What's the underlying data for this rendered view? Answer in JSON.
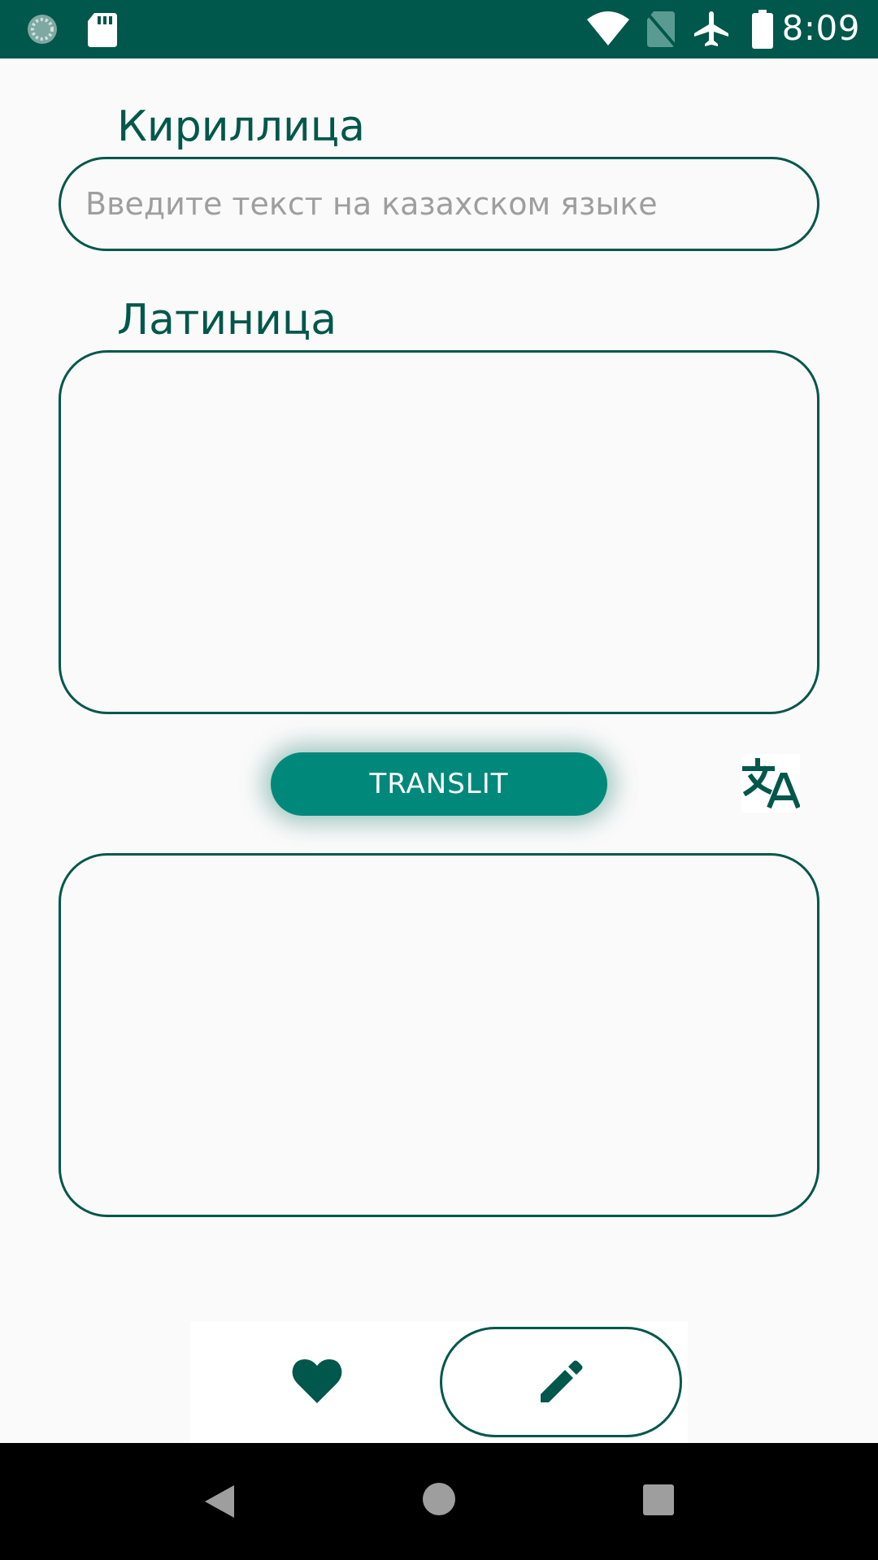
{
  "status_bar": {
    "time": "8:09",
    "icons": [
      "loading-icon",
      "sd-card-icon",
      "wifi-icon",
      "no-sim-icon",
      "airplane-icon",
      "battery-icon"
    ]
  },
  "cyrillic": {
    "label": "Кириллица",
    "placeholder": "Введите текст на казахском языке",
    "value": ""
  },
  "latin": {
    "label": "Латиница",
    "value": ""
  },
  "translit_button": {
    "label": "TRANSLIT"
  },
  "output": {
    "value": ""
  },
  "bottom_nav": {
    "items": [
      {
        "icon": "heart-icon",
        "selected": false
      },
      {
        "icon": "pencil-icon",
        "selected": true
      }
    ]
  },
  "system_nav": {
    "buttons": [
      "back-icon",
      "home-icon",
      "recents-icon"
    ]
  },
  "colors": {
    "primary_dark": "#00574b",
    "accent": "#00897b",
    "background": "#fafafa"
  }
}
